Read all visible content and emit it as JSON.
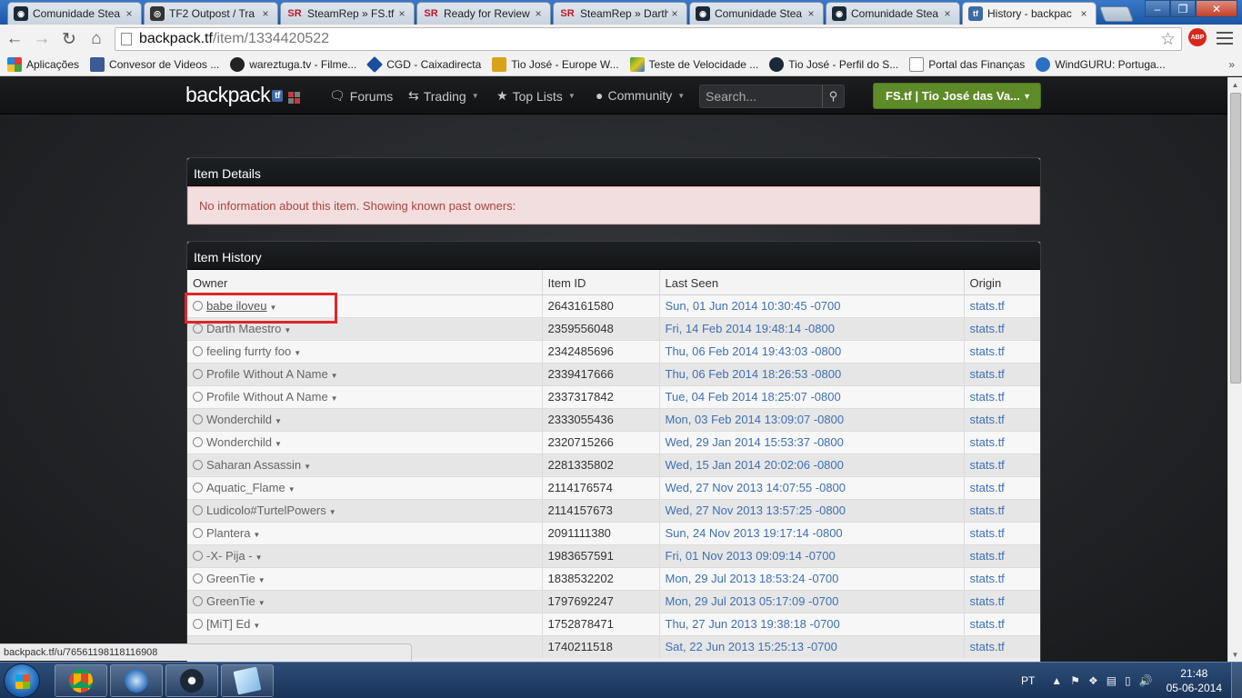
{
  "browser": {
    "tabs": [
      {
        "label": "Comunidade Stea",
        "favicon": "steam"
      },
      {
        "label": "TF2 Outpost / Tra",
        "favicon": "outpost"
      },
      {
        "label": "SteamRep » FS.tf |",
        "favicon": "SR"
      },
      {
        "label": "Ready for Review",
        "favicon": "SR"
      },
      {
        "label": "SteamRep » Darth",
        "favicon": "SR"
      },
      {
        "label": "Comunidade Stea",
        "favicon": "steam"
      },
      {
        "label": "Comunidade Stea",
        "favicon": "steam"
      },
      {
        "label": "History - backpac",
        "favicon": "tf",
        "active": true
      }
    ],
    "favicon_text": {
      "sr": "SR",
      "tf": "tf"
    },
    "url_host": "backpack.tf",
    "url_path": "/item/1334420522",
    "abp_label": "ABP",
    "bookmarks": [
      {
        "label": "Aplicações",
        "icon": "apps-grid-icon"
      },
      {
        "label": "Convesor de Videos ...",
        "icon": "yt-icon"
      },
      {
        "label": "wareztuga.tv - Filme...",
        "icon": "wareztuga-icon"
      },
      {
        "label": "CGD - Caixadirecta",
        "icon": "cgd-icon"
      },
      {
        "label": "Tio José - Europe W...",
        "icon": "crown-icon"
      },
      {
        "label": "Teste de Velocidade ...",
        "icon": "speed-icon"
      },
      {
        "label": "Tio José - Perfil do S...",
        "icon": "steam-icon"
      },
      {
        "label": "Portal das Finanças",
        "icon": "page-icon"
      },
      {
        "label": "WindGURU: Portuga...",
        "icon": "windguru-icon"
      }
    ],
    "bookmarks_more": "»",
    "status_url": "backpack.tf/u/76561198118116908"
  },
  "site": {
    "brand": "backpack",
    "brand_badge": "tf",
    "nav": [
      {
        "label": "Forums",
        "icon": "comments-icon",
        "dropdown": false
      },
      {
        "label": "Trading",
        "icon": "exchange-icon",
        "dropdown": true
      },
      {
        "label": "Top Lists",
        "icon": "star-icon",
        "dropdown": true
      },
      {
        "label": "Community",
        "icon": "globe-icon",
        "dropdown": true
      }
    ],
    "search_placeholder": "Search...",
    "user_label": "FS.tf | Tio José das Va..."
  },
  "item_details": {
    "title": "Item Details",
    "alert": "No information about this item. Showing known past owners:"
  },
  "item_history": {
    "title": "Item History",
    "columns": [
      "Owner",
      "Item ID",
      "Last Seen",
      "Origin"
    ],
    "rows": [
      {
        "owner": "babe iloveu",
        "item_id": "2643161580",
        "last_seen": "Sun, 01 Jun 2014 10:30:45 -0700",
        "origin": "stats.tf"
      },
      {
        "owner": "Darth Maestro",
        "item_id": "2359556048",
        "last_seen": "Fri, 14 Feb 2014 19:48:14 -0800",
        "origin": "stats.tf"
      },
      {
        "owner": "feeling furrty foo",
        "item_id": "2342485696",
        "last_seen": "Thu, 06 Feb 2014 19:43:03 -0800",
        "origin": "stats.tf"
      },
      {
        "owner": "Profile Without A Name",
        "item_id": "2339417666",
        "last_seen": "Thu, 06 Feb 2014 18:26:53 -0800",
        "origin": "stats.tf"
      },
      {
        "owner": "Profile Without A Name",
        "item_id": "2337317842",
        "last_seen": "Tue, 04 Feb 2014 18:25:07 -0800",
        "origin": "stats.tf"
      },
      {
        "owner": "Wonderchild",
        "item_id": "2333055436",
        "last_seen": "Mon, 03 Feb 2014 13:09:07 -0800",
        "origin": "stats.tf"
      },
      {
        "owner": "Wonderchild",
        "item_id": "2320715266",
        "last_seen": "Wed, 29 Jan 2014 15:53:37 -0800",
        "origin": "stats.tf"
      },
      {
        "owner": "Saharan Assassin",
        "item_id": "2281335802",
        "last_seen": "Wed, 15 Jan 2014 20:02:06 -0800",
        "origin": "stats.tf"
      },
      {
        "owner": "Aquatic_Flame",
        "item_id": "2114176574",
        "last_seen": "Wed, 27 Nov 2013 14:07:55 -0800",
        "origin": "stats.tf"
      },
      {
        "owner": "Ludicolo#TurtelPowers",
        "item_id": "2114157673",
        "last_seen": "Wed, 27 Nov 2013 13:57:25 -0800",
        "origin": "stats.tf"
      },
      {
        "owner": "Plantera",
        "item_id": "2091111380",
        "last_seen": "Sun, 24 Nov 2013 19:17:14 -0800",
        "origin": "stats.tf"
      },
      {
        "owner": "-X- Pija -",
        "item_id": "1983657591",
        "last_seen": "Fri, 01 Nov 2013 09:09:14 -0700",
        "origin": "stats.tf"
      },
      {
        "owner": "GreenTie",
        "item_id": "1838532202",
        "last_seen": "Mon, 29 Jul 2013 18:53:24 -0700",
        "origin": "stats.tf"
      },
      {
        "owner": "GreenTie",
        "item_id": "1797692247",
        "last_seen": "Mon, 29 Jul 2013 05:17:09 -0700",
        "origin": "stats.tf"
      },
      {
        "owner": "[MiT] Ed",
        "item_id": "1752878471",
        "last_seen": "Thu, 27 Jun 2013 19:38:18 -0700",
        "origin": "stats.tf"
      },
      {
        "owner": "",
        "item_id": "1740211518",
        "last_seen": "Sat, 22 Jun 2013 15:25:13 -0700",
        "origin": "stats.tf"
      }
    ]
  },
  "taskbar": {
    "apps": [
      "chrome-icon",
      "media-player-icon",
      "steam-icon",
      "notepad-icon"
    ],
    "language": "PT",
    "time": "21:48",
    "date": "05-06-2014"
  },
  "colors": {
    "accent_green": "#5f8a28",
    "link_blue": "#3f6fb3",
    "alert_bg": "#f2dede",
    "alert_text": "#a94442",
    "highlight_red": "#e0242b"
  }
}
